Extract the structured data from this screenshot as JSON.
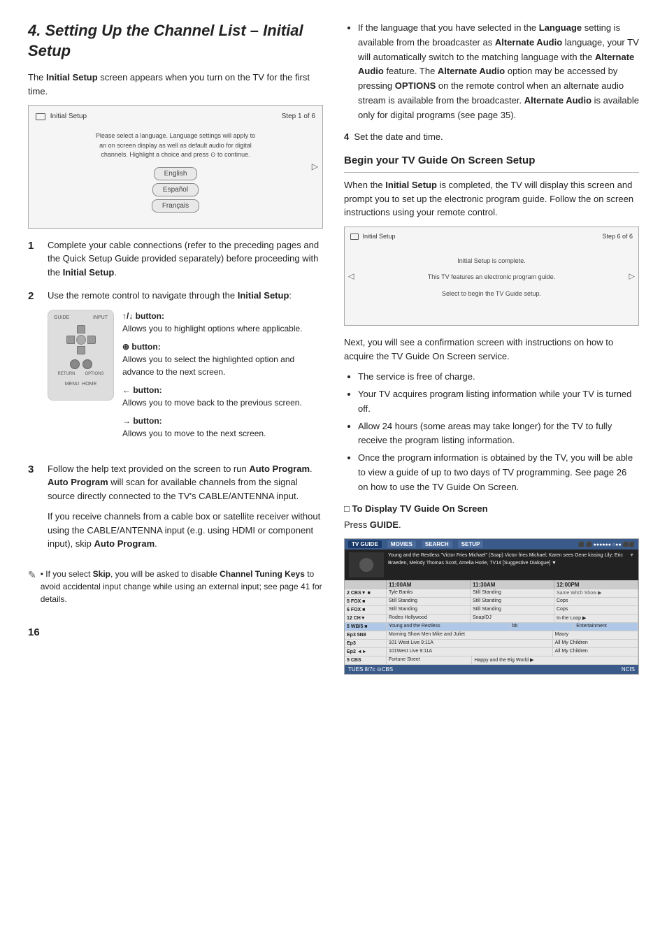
{
  "page": {
    "title": "4. Setting Up the Channel List – Initial Setup",
    "page_number": "16"
  },
  "left": {
    "intro": "The ",
    "intro_bold": "Initial Setup",
    "intro_rest": " screen appears when you turn on the TV for the first time.",
    "screen1": {
      "title": "Initial Setup",
      "step": "Step 1 of 6",
      "body_text": "Please select a language. Language settings will apply to\nan on screen display as well as default audio for digital\nchannels. Highlight a choice and press  to continue.",
      "lang1": "English",
      "lang2": "Español",
      "lang3": "Français"
    },
    "steps": [
      {
        "num": "1",
        "text": "Complete your cable connections (refer to the preceding pages and the Quick Setup Guide provided separately) before proceeding with the ",
        "bold": "Initial Setup",
        "text2": "."
      },
      {
        "num": "2",
        "text": "Use the remote control to navigate through the ",
        "bold": "Initial Setup",
        "text2": ":"
      }
    ],
    "up_down_button_label": "↑/↓ button:",
    "up_down_button_desc": "Allows you to highlight options where applicable.",
    "circle_button_label": "⊕ button:",
    "circle_button_desc": "Allows you to select the highlighted option and advance to the next screen.",
    "left_button_label": "← button:",
    "left_button_desc": "Allows you to move back to the previous screen.",
    "right_button_label": "→ button:",
    "right_button_desc": "Allows you to move to the next screen.",
    "step3_num": "3",
    "step3_text": "Follow the help text provided on the screen to run ",
    "step3_bold1": "Auto Program",
    "step3_mid": ". ",
    "step3_bold2": "Auto Program",
    "step3_rest": " will scan for available channels from the signal source directly connected to the TV's CABLE/ANTENNA input.",
    "step3_para2": "If you receive channels from a cable box or satellite receiver without using the CABLE/ANTENNA input (e.g. using HDMI or component input), skip ",
    "step3_bold3": "Auto Program",
    "step3_end": ".",
    "note_bold1": "Skip",
    "note_text1": ", you will be asked to disable ",
    "note_bold2": "Channel Tuning Keys",
    "note_text2": " to avoid accidental input change while using an external input; see page 41 for details."
  },
  "right": {
    "bullet1_prefix": "If the language that you have selected in the ",
    "bullet1_bold1": "Language",
    "bullet1_mid": " setting is available from the broadcaster as ",
    "bullet1_bold2": "Alternate Audio",
    "bullet1_rest1": " language, your TV will automatically switch to the matching language with the ",
    "bullet1_bold3": "Alternate Audio",
    "bullet1_rest2": " feature. The ",
    "bullet1_bold4": "Alternate Audio",
    "bullet1_rest3": " option may be accessed by pressing ",
    "bullet1_bold5": "OPTIONS",
    "bullet1_rest4": " on the remote control when an alternate audio stream is available from the broadcaster. ",
    "bullet1_bold6": "Alternate Audio",
    "bullet1_rest5": " is available only for digital programs (see page 35).",
    "step4_num": "4",
    "step4_text": "Set the date and time.",
    "section_heading": "Begin your TV Guide On Screen Setup",
    "section_intro": "When the ",
    "section_intro_bold": "Initial Setup",
    "section_intro_rest": " is completed, the TV will display this screen and prompt you to set up the electronic program guide. Follow the on screen instructions using your remote control.",
    "screen2": {
      "title": "Initial Setup",
      "step": "Step 6 of 6",
      "line1": "Initial Setup is complete.",
      "line2": "This TV features an electronic program guide.",
      "line3": "Select  to begin the TV Guide setup."
    },
    "next_para": "Next, you will see a confirmation screen with instructions on how to acquire the TV Guide On Screen service.",
    "bullets": [
      "The service is free of charge.",
      "Your TV acquires program listing information while your TV is turned off.",
      "Allow 24 hours (some areas may take longer) for the TV to fully receive the program listing information.",
      "Once the program information is obtained by the TV, you will be able to view a guide of up to two days of TV programming. See page 26 on how to use the TV Guide On Screen."
    ],
    "guide_heading": "□ To Display TV Guide On Screen",
    "guide_press": "Press ",
    "guide_bold": "GUIDE",
    "guide_end": ".",
    "guide_screen": {
      "tabs": [
        "TV GUIDE",
        "MOVIES",
        "SEARCH",
        "SETUP"
      ],
      "info_text": "Young and the Restless \"Victor Fries Michael\" (Soap) Victor fries Michael; Karen sees Gene kissing Lily; Eric Braeden, Melody Thomas Scott, Amelia Horie, TV14 [Suggestive Dialogue] ▼",
      "time_slots": [
        "11:00AM",
        "11:30AM",
        "12:00PM"
      ],
      "channels": [
        {
          "id": "2 CBS▼ ■",
          "prog1": "Tyle Banks",
          "prog2": "Still Standing",
          "prog3": "Same Witch Show ▶"
        },
        {
          "id": "5 FOX ■ ↓ ↑",
          "prog1": "Still Standing",
          "prog2": "Still Standing",
          "prog3": "Cops"
        },
        {
          "id": "6 FOX ■ ↓ ↑",
          "prog1": "Still Standing",
          "prog2": "Still Standing",
          "prog3": "Cops"
        },
        {
          "id": "12 CH▼",
          "prog1": "Rodeo Hollywood",
          "prog2": "Soap/DJ",
          "prog3": "In the Loop ↘ ▶"
        },
        {
          "id": "5 WB/5 ■",
          "prog1": "Young and the Restless",
          "prog2": "bb",
          "prog3": "Entertainment"
        },
        {
          "id": "Ep3 5N8",
          "prog1": "Morning Show Men Make and Juliet",
          "prog2": "",
          "prog3": "Maury"
        },
        {
          "id": "Ep3",
          "prog1": "101 West Live 9:11A",
          "prog2": "",
          "prog3": "All My Children"
        },
        {
          "id": "Ep2 ◄►",
          "prog1": "101West Live 9:11A",
          "prog2": "",
          "prog3": "All My Children"
        },
        {
          "id": "5 CBS",
          "prog1": "Fortune Street",
          "prog2": "",
          "prog3": "Happy and the Big World ▶"
        }
      ],
      "bottom_left": "TUES 8/7c CBS",
      "bottom_right": "NCIS"
    }
  }
}
